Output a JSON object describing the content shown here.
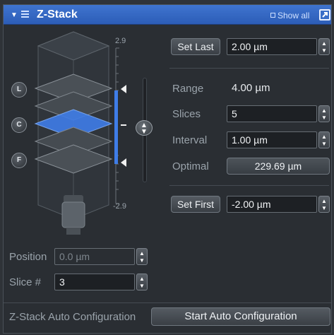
{
  "header": {
    "title": "Z-Stack",
    "show_all": "Show all"
  },
  "graphic": {
    "top_value": "2.9",
    "bottom_value": "-2.9",
    "buttons": {
      "last": "L",
      "center": "C",
      "first": "F"
    }
  },
  "controls": {
    "set_last_label": "Set Last",
    "last_value": "2.00 µm",
    "range_label": "Range",
    "range_value": "4.00 µm",
    "slices_label": "Slices",
    "slices_value": "5",
    "interval_label": "Interval",
    "interval_value": "1.00 µm",
    "optimal_label": "Optimal",
    "optimal_value": "229.69 µm",
    "set_first_label": "Set First",
    "first_value": "-2.00 µm"
  },
  "left": {
    "position_label": "Position",
    "position_value": "0.0 µm",
    "slice_label": "Slice #",
    "slice_value": "3"
  },
  "footer": {
    "auto_config_label": "Z-Stack Auto Configuration",
    "start_button": "Start Auto Configuration"
  },
  "colors": {
    "header": "#3a6ec8",
    "active_slice": "#3f7de8",
    "background": "#2a2e33"
  }
}
